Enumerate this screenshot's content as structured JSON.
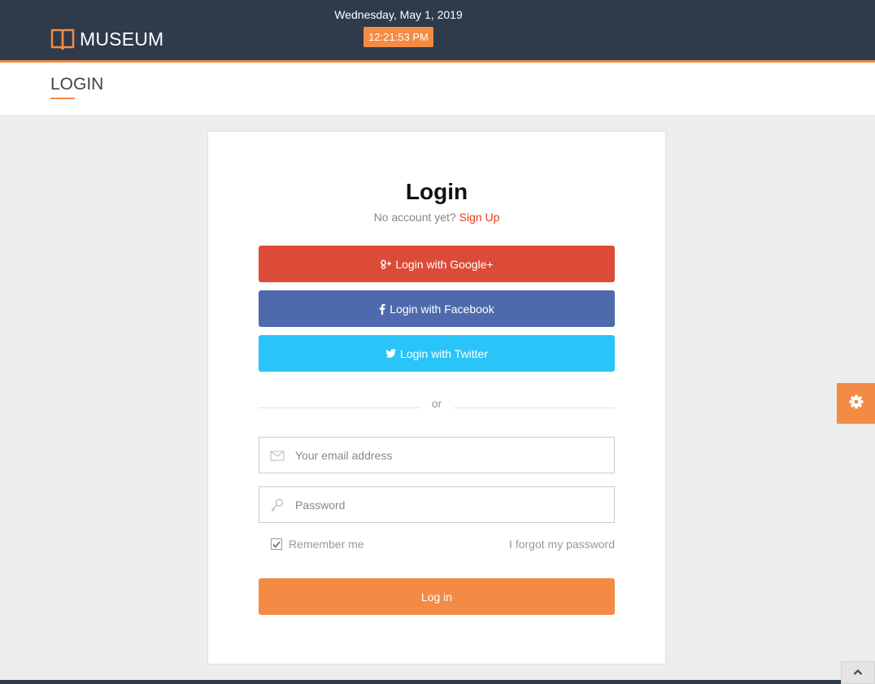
{
  "header": {
    "brand_name": "MUSEUM",
    "brand_icon": "book-icon",
    "date": "Wednesday, May 1, 2019",
    "time": "12:21:53 PM"
  },
  "page": {
    "title": "LOGIN"
  },
  "login_card": {
    "title": "Login",
    "no_account_text": "No account yet?",
    "signup_link": "Sign Up",
    "social": {
      "google": {
        "label": "Login with Google+",
        "icon": "google-plus-icon"
      },
      "facebook": {
        "label": "Login with Facebook",
        "icon": "facebook-icon"
      },
      "twitter": {
        "label": "Login with Twitter",
        "icon": "twitter-icon"
      }
    },
    "divider_text": "or",
    "email_field": {
      "placeholder": "Your email address",
      "value": "",
      "icon": "envelope-icon"
    },
    "password_field": {
      "placeholder": "Password",
      "value": "",
      "icon": "key-icon"
    },
    "remember_me": {
      "label": "Remember me",
      "checked": true
    },
    "forgot_link": "I forgot my password",
    "submit_label": "Log in"
  },
  "widgets": {
    "settings_icon": "gear-icon",
    "scroll_top_icon": "chevron-up-icon"
  },
  "colors": {
    "header_bg": "#2f3a4a",
    "accent": "#f38b45",
    "google": "#dc4b38",
    "facebook": "#4e6aad",
    "twitter": "#29c4f8",
    "signup_link": "#e23b1a"
  }
}
